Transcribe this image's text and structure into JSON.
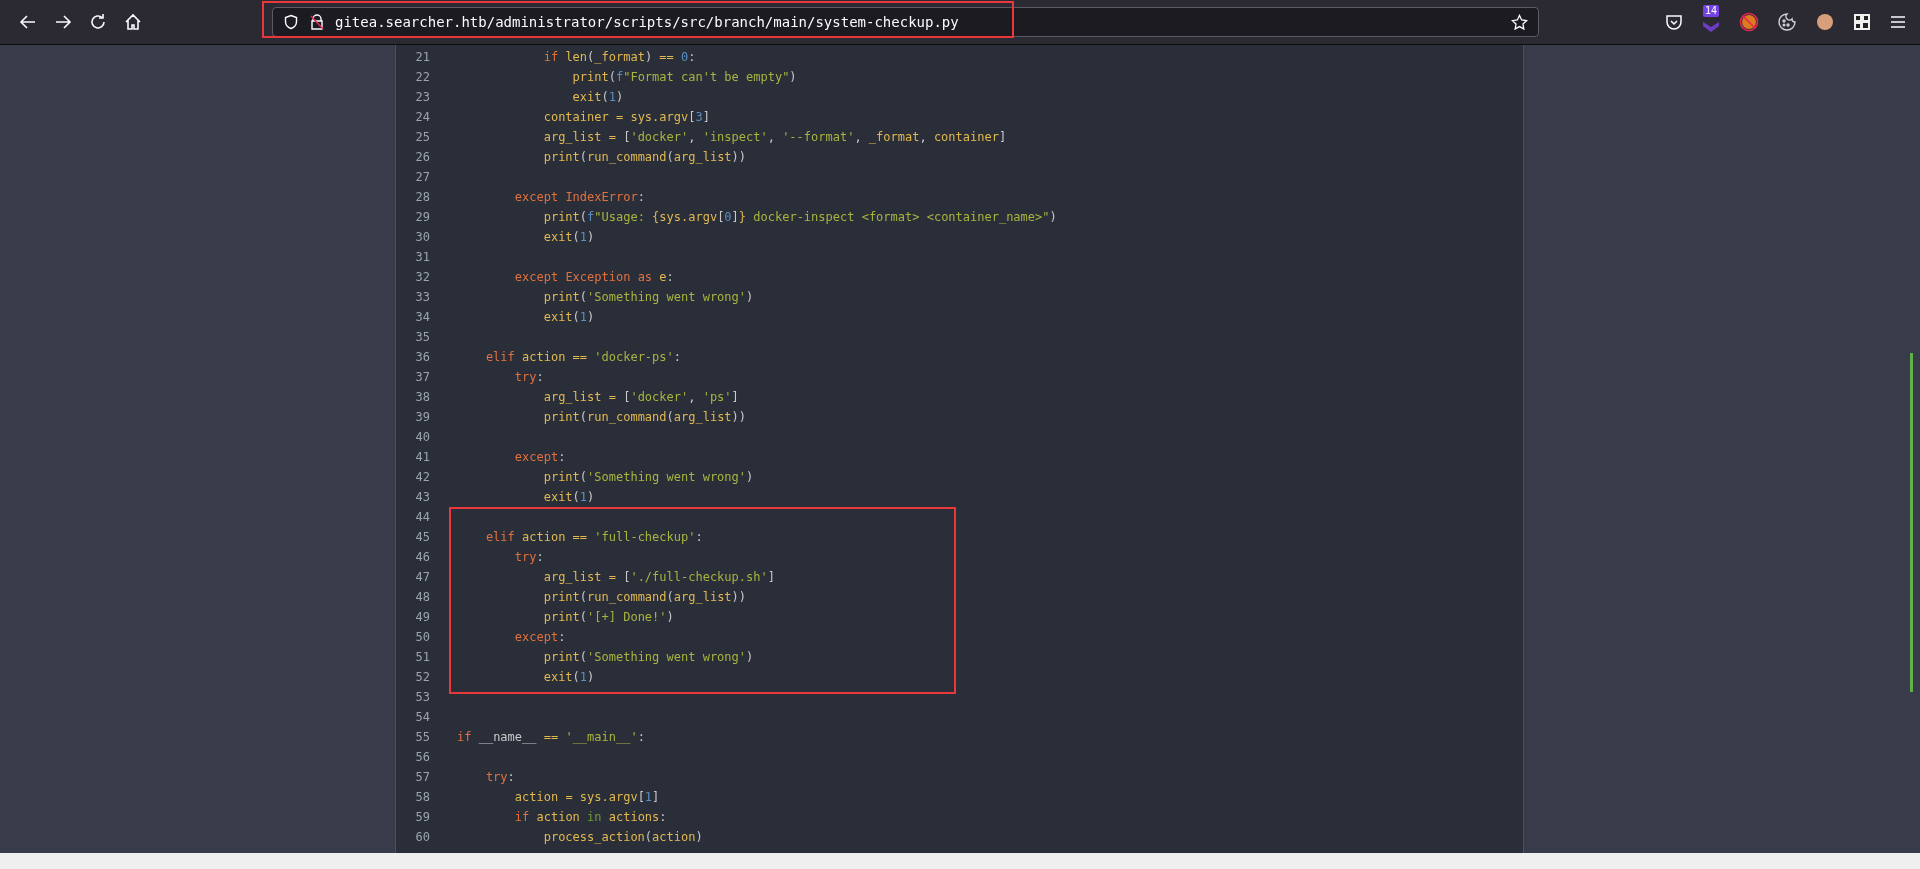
{
  "address_bar": {
    "url": "gitea.searcher.htb/administrator/scripts/src/branch/main/system-checkup.py",
    "highlighted": true
  },
  "toolbar": {
    "extension_badge": "14"
  },
  "code": {
    "blocks": [
      {
        "highlighted": false,
        "lines": [
          {
            "number": "21",
            "tokens": [
              {
                "kind": "keyword",
                "text": "            if "
              },
              {
                "kind": "name",
                "text": "len"
              },
              {
                "kind": "punct",
                "text": "("
              },
              {
                "kind": "name",
                "text": "_format"
              },
              {
                "kind": "punct",
                "text": ") "
              },
              {
                "kind": "op",
                "text": "== "
              },
              {
                "kind": "number",
                "text": "0"
              },
              {
                "kind": "punct",
                "text": ":"
              }
            ]
          },
          {
            "number": "22",
            "tokens": [
              {
                "kind": "name",
                "text": "                print"
              },
              {
                "kind": "punct",
                "text": "("
              },
              {
                "kind": "number",
                "text": "f"
              },
              {
                "kind": "string",
                "text": "\"Format can't be empty\""
              },
              {
                "kind": "punct",
                "text": ")"
              }
            ]
          },
          {
            "number": "23",
            "tokens": [
              {
                "kind": "name",
                "text": "                exit"
              },
              {
                "kind": "punct",
                "text": "("
              },
              {
                "kind": "number",
                "text": "1"
              },
              {
                "kind": "punct",
                "text": ")"
              }
            ]
          },
          {
            "number": "24",
            "tokens": [
              {
                "kind": "name",
                "text": "            container "
              },
              {
                "kind": "op",
                "text": "= "
              },
              {
                "kind": "name",
                "text": "sys.argv"
              },
              {
                "kind": "punct",
                "text": "["
              },
              {
                "kind": "number",
                "text": "3"
              },
              {
                "kind": "punct",
                "text": "]"
              }
            ]
          },
          {
            "number": "25",
            "tokens": [
              {
                "kind": "name",
                "text": "            arg_list "
              },
              {
                "kind": "op",
                "text": "= "
              },
              {
                "kind": "punct",
                "text": "["
              },
              {
                "kind": "string",
                "text": "'docker'"
              },
              {
                "kind": "punct",
                "text": ", "
              },
              {
                "kind": "string",
                "text": "'inspect'"
              },
              {
                "kind": "punct",
                "text": ", "
              },
              {
                "kind": "string",
                "text": "'--format'"
              },
              {
                "kind": "punct",
                "text": ", "
              },
              {
                "kind": "name",
                "text": "_format"
              },
              {
                "kind": "punct",
                "text": ", "
              },
              {
                "kind": "name",
                "text": "container"
              },
              {
                "kind": "punct",
                "text": "]"
              }
            ]
          },
          {
            "number": "26",
            "tokens": [
              {
                "kind": "name",
                "text": "            print"
              },
              {
                "kind": "punct",
                "text": "("
              },
              {
                "kind": "name",
                "text": "run_command"
              },
              {
                "kind": "punct",
                "text": "("
              },
              {
                "kind": "name",
                "text": "arg_list"
              },
              {
                "kind": "punct",
                "text": "))"
              }
            ]
          },
          {
            "number": "27"
          },
          {
            "number": "28",
            "tokens": [
              {
                "kind": "keyword",
                "text": "        except "
              },
              {
                "kind": "keyword",
                "text": "IndexError"
              },
              {
                "kind": "punct",
                "text": ":"
              }
            ]
          },
          {
            "number": "29",
            "tokens": [
              {
                "kind": "name",
                "text": "            print"
              },
              {
                "kind": "punct",
                "text": "("
              },
              {
                "kind": "number",
                "text": "f"
              },
              {
                "kind": "string",
                "text": "\"Usage: "
              },
              {
                "kind": "name",
                "text": "{sys.argv"
              },
              {
                "kind": "punct",
                "text": "["
              },
              {
                "kind": "number",
                "text": "0"
              },
              {
                "kind": "punct",
                "text": "]"
              },
              {
                "kind": "name",
                "text": "}"
              },
              {
                "kind": "string",
                "text": " docker-inspect <format> <container_name>\""
              },
              {
                "kind": "punct",
                "text": ")"
              }
            ]
          },
          {
            "number": "30",
            "tokens": [
              {
                "kind": "name",
                "text": "            exit"
              },
              {
                "kind": "punct",
                "text": "("
              },
              {
                "kind": "number",
                "text": "1"
              },
              {
                "kind": "punct",
                "text": ")"
              }
            ]
          },
          {
            "number": "31"
          },
          {
            "number": "32",
            "tokens": [
              {
                "kind": "keyword",
                "text": "        except "
              },
              {
                "kind": "keyword",
                "text": "Exception "
              },
              {
                "kind": "keyword",
                "text": "as "
              },
              {
                "kind": "name",
                "text": "e"
              },
              {
                "kind": "punct",
                "text": ":"
              }
            ]
          },
          {
            "number": "33",
            "tokens": [
              {
                "kind": "name",
                "text": "            print"
              },
              {
                "kind": "punct",
                "text": "("
              },
              {
                "kind": "string",
                "text": "'Something went wrong'"
              },
              {
                "kind": "punct",
                "text": ")"
              }
            ]
          },
          {
            "number": "34",
            "tokens": [
              {
                "kind": "name",
                "text": "            exit"
              },
              {
                "kind": "punct",
                "text": "("
              },
              {
                "kind": "number",
                "text": "1"
              },
              {
                "kind": "punct",
                "text": ")"
              }
            ]
          },
          {
            "number": "35"
          },
          {
            "number": "36",
            "tokens": [
              {
                "kind": "keyword",
                "text": "    elif "
              },
              {
                "kind": "name",
                "text": "action "
              },
              {
                "kind": "op",
                "text": "== "
              },
              {
                "kind": "string",
                "text": "'docker-ps'"
              },
              {
                "kind": "punct",
                "text": ":"
              }
            ]
          },
          {
            "number": "37",
            "tokens": [
              {
                "kind": "keyword",
                "text": "        try"
              },
              {
                "kind": "punct",
                "text": ":"
              }
            ]
          },
          {
            "number": "38",
            "tokens": [
              {
                "kind": "name",
                "text": "            arg_list "
              },
              {
                "kind": "op",
                "text": "= "
              },
              {
                "kind": "punct",
                "text": "["
              },
              {
                "kind": "string",
                "text": "'docker'"
              },
              {
                "kind": "punct",
                "text": ", "
              },
              {
                "kind": "string",
                "text": "'ps'"
              },
              {
                "kind": "punct",
                "text": "]"
              }
            ]
          },
          {
            "number": "39",
            "tokens": [
              {
                "kind": "name",
                "text": "            print"
              },
              {
                "kind": "punct",
                "text": "("
              },
              {
                "kind": "name",
                "text": "run_command"
              },
              {
                "kind": "punct",
                "text": "("
              },
              {
                "kind": "name",
                "text": "arg_list"
              },
              {
                "kind": "punct",
                "text": "))"
              }
            ]
          },
          {
            "number": "40"
          },
          {
            "number": "41",
            "tokens": [
              {
                "kind": "keyword",
                "text": "        except"
              },
              {
                "kind": "punct",
                "text": ":"
              }
            ]
          },
          {
            "number": "42",
            "tokens": [
              {
                "kind": "name",
                "text": "            print"
              },
              {
                "kind": "punct",
                "text": "("
              },
              {
                "kind": "string",
                "text": "'Something went wrong'"
              },
              {
                "kind": "punct",
                "text": ")"
              }
            ]
          },
          {
            "number": "43",
            "tokens": [
              {
                "kind": "name",
                "text": "            exit"
              },
              {
                "kind": "punct",
                "text": "("
              },
              {
                "kind": "number",
                "text": "1"
              },
              {
                "kind": "punct",
                "text": ")"
              }
            ]
          }
        ]
      },
      {
        "highlighted": true,
        "lines": [
          {
            "number": "44"
          },
          {
            "number": "45",
            "tokens": [
              {
                "kind": "keyword",
                "text": "    elif "
              },
              {
                "kind": "name",
                "text": "action "
              },
              {
                "kind": "op",
                "text": "== "
              },
              {
                "kind": "string",
                "text": "'full-checkup'"
              },
              {
                "kind": "punct",
                "text": ":"
              }
            ]
          },
          {
            "number": "46",
            "tokens": [
              {
                "kind": "keyword",
                "text": "        try"
              },
              {
                "kind": "punct",
                "text": ":"
              }
            ]
          },
          {
            "number": "47",
            "tokens": [
              {
                "kind": "name",
                "text": "            arg_list "
              },
              {
                "kind": "op",
                "text": "= "
              },
              {
                "kind": "punct",
                "text": "["
              },
              {
                "kind": "string",
                "text": "'./full-checkup.sh'"
              },
              {
                "kind": "punct",
                "text": "]"
              }
            ]
          },
          {
            "number": "48",
            "tokens": [
              {
                "kind": "name",
                "text": "            print"
              },
              {
                "kind": "punct",
                "text": "("
              },
              {
                "kind": "name",
                "text": "run_command"
              },
              {
                "kind": "punct",
                "text": "("
              },
              {
                "kind": "name",
                "text": "arg_list"
              },
              {
                "kind": "punct",
                "text": "))"
              }
            ]
          },
          {
            "number": "49",
            "tokens": [
              {
                "kind": "name",
                "text": "            print"
              },
              {
                "kind": "punct",
                "text": "("
              },
              {
                "kind": "string",
                "text": "'[+] Done!'"
              },
              {
                "kind": "punct",
                "text": ")"
              }
            ]
          },
          {
            "number": "50",
            "tokens": [
              {
                "kind": "keyword",
                "text": "        except"
              },
              {
                "kind": "punct",
                "text": ":"
              }
            ]
          },
          {
            "number": "51",
            "tokens": [
              {
                "kind": "name",
                "text": "            print"
              },
              {
                "kind": "punct",
                "text": "("
              },
              {
                "kind": "string",
                "text": "'Something went wrong'"
              },
              {
                "kind": "punct",
                "text": ")"
              }
            ]
          },
          {
            "number": "52",
            "tokens": [
              {
                "kind": "name",
                "text": "            exit"
              },
              {
                "kind": "punct",
                "text": "("
              },
              {
                "kind": "number",
                "text": "1"
              },
              {
                "kind": "punct",
                "text": ")"
              }
            ]
          }
        ]
      },
      {
        "highlighted": false,
        "lines": [
          {
            "number": "53"
          },
          {
            "number": "54"
          },
          {
            "number": "55",
            "tokens": [
              {
                "kind": "keyword",
                "text": "if "
              },
              {
                "kind": "plain",
                "text": "__name__ "
              },
              {
                "kind": "op",
                "text": "== "
              },
              {
                "kind": "string",
                "text": "'__main__'"
              },
              {
                "kind": "punct",
                "text": ":"
              }
            ]
          },
          {
            "number": "56"
          },
          {
            "number": "57",
            "tokens": [
              {
                "kind": "keyword",
                "text": "    try"
              },
              {
                "kind": "punct",
                "text": ":"
              }
            ]
          },
          {
            "number": "58",
            "tokens": [
              {
                "kind": "name",
                "text": "        action "
              },
              {
                "kind": "op",
                "text": "= "
              },
              {
                "kind": "name",
                "text": "sys.argv"
              },
              {
                "kind": "punct",
                "text": "["
              },
              {
                "kind": "number",
                "text": "1"
              },
              {
                "kind": "punct",
                "text": "]"
              }
            ]
          },
          {
            "number": "59",
            "tokens": [
              {
                "kind": "keyword",
                "text": "        if "
              },
              {
                "kind": "name",
                "text": "action "
              },
              {
                "kind": "operator_word",
                "text": "in "
              },
              {
                "kind": "name",
                "text": "actions"
              },
              {
                "kind": "punct",
                "text": ":"
              }
            ]
          },
          {
            "number": "60",
            "tokens": [
              {
                "kind": "name",
                "text": "            process_action"
              },
              {
                "kind": "punct",
                "text": "("
              },
              {
                "kind": "name",
                "text": "action"
              },
              {
                "kind": "punct",
                "text": ")"
              }
            ]
          }
        ]
      }
    ]
  }
}
